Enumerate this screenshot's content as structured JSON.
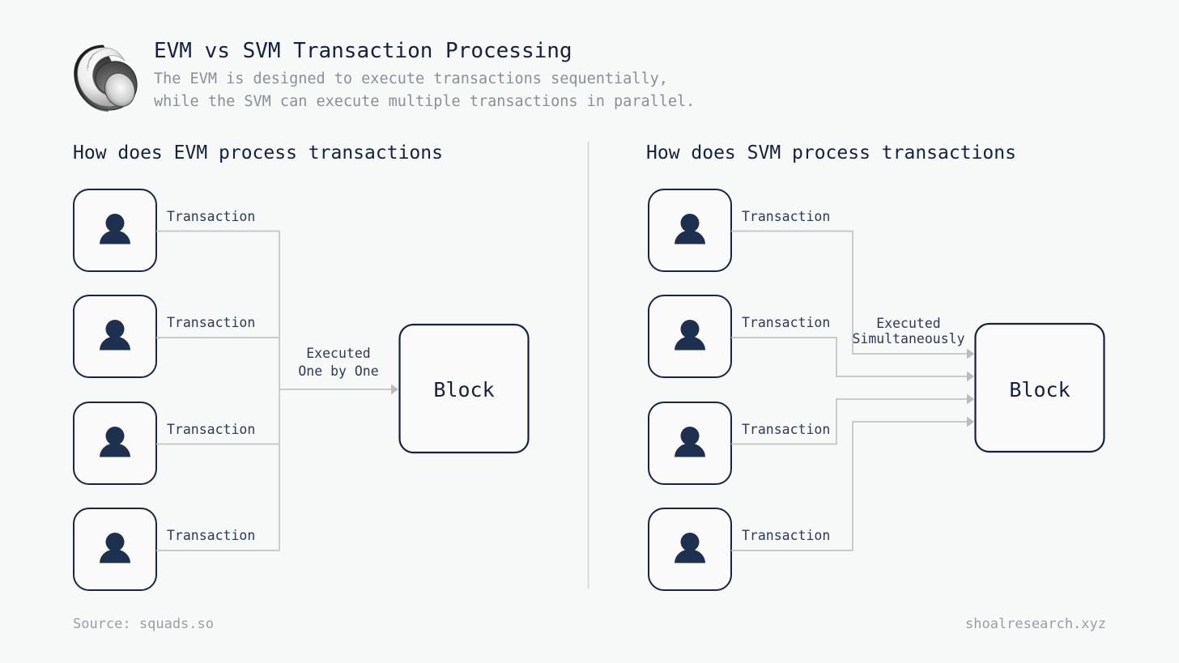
{
  "header": {
    "logo_icon": "snail-shell-logo",
    "title": "EVM vs SVM Transaction Processing",
    "subtitle_line1": "The EVM is designed to execute transactions sequentially,",
    "subtitle_line2": "while the SVM can execute multiple transactions in parallel."
  },
  "sections": {
    "evm": {
      "heading": "How does EVM process transactions",
      "transactions": [
        {
          "label": "Transaction"
        },
        {
          "label": "Transaction"
        },
        {
          "label": "Transaction"
        },
        {
          "label": "Transaction"
        }
      ],
      "flow_label_line1": "Executed",
      "flow_label_line2": "One by One",
      "block_label": "Block"
    },
    "svm": {
      "heading": "How does SVM process transactions",
      "transactions": [
        {
          "label": "Transaction"
        },
        {
          "label": "Transaction"
        },
        {
          "label": "Transaction"
        },
        {
          "label": "Transaction"
        }
      ],
      "flow_label_line1": "Executed",
      "flow_label_line2": "Simultaneously",
      "block_label": "Block"
    }
  },
  "footer": {
    "source": "Source: squads.so",
    "site": "shoalresearch.xyz"
  },
  "colors": {
    "background": "#f7f8f8",
    "ink": "#16213e",
    "muted": "#8a8f98",
    "connector": "#c2c4c6",
    "person": "#1e3050",
    "box_fill": "#fafafa"
  }
}
